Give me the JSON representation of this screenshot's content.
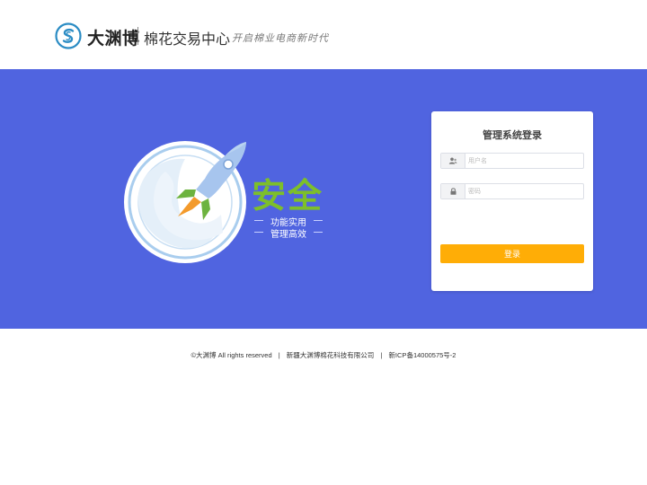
{
  "header": {
    "brand": "大渊博",
    "subtitle": "棉花交易中心",
    "slogan": "开启棉业电商新时代"
  },
  "hero": {
    "title": "安全",
    "line1": "功能实用",
    "line2": "管理高效"
  },
  "login": {
    "title": "管理系统登录",
    "username_placeholder": "用户名",
    "password_placeholder": "密码",
    "submit_label": "登录"
  },
  "footer": {
    "copyright": "©大渊博 All rights reserved",
    "company": "新疆大渊博棉花科技有限公司",
    "icp": "新ICP备14000575号-2"
  },
  "colors": {
    "banner": "#5064e0",
    "accent_button": "#ffad06",
    "logo": "#2b8cc4",
    "hero_text": "#7dbf2a"
  },
  "icons": [
    "logo-mark-icon",
    "user-icon",
    "lock-icon",
    "rocket-icon"
  ]
}
